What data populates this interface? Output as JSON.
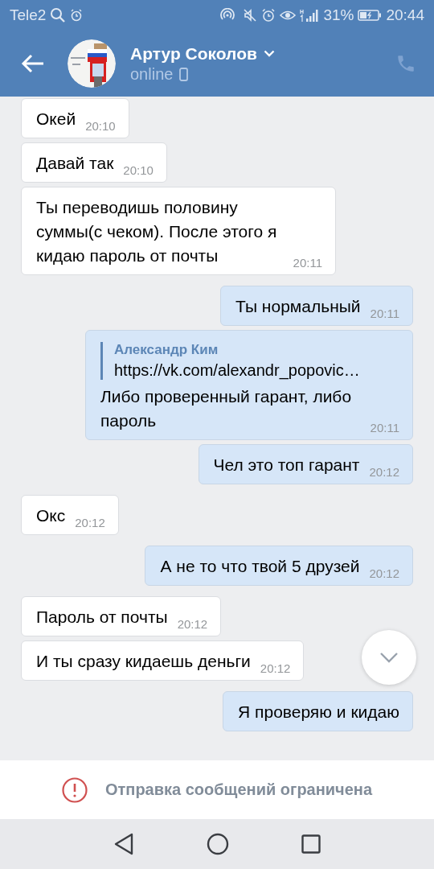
{
  "status_bar": {
    "carrier": "Tele2",
    "battery": "31%",
    "time": "20:44"
  },
  "header": {
    "name": "Артур Соколов",
    "status": "online"
  },
  "messages": [
    {
      "kind": "in",
      "text": "Окей",
      "time": "20:10"
    },
    {
      "kind": "in",
      "text": "Давай так",
      "time": "20:10"
    },
    {
      "kind": "in",
      "text": "Ты переводишь половину суммы(с чеком). После этого я кидаю пароль от почты",
      "time": "20:11"
    },
    {
      "kind": "out",
      "text": "Ты нормальный",
      "time": "20:11"
    },
    {
      "kind": "out",
      "reply": {
        "author": "Александр Ким",
        "text": "https://vk.com/alexandr_popovic…"
      },
      "text": "Либо проверенный гарант, либо пароль",
      "time": "20:11"
    },
    {
      "kind": "out",
      "text": "Чел это топ гарант",
      "time": "20:12"
    },
    {
      "kind": "in",
      "text": "Окс",
      "time": "20:12"
    },
    {
      "kind": "out",
      "text": "А не то что твой 5 друзей",
      "time": "20:12"
    },
    {
      "kind": "in",
      "text": "Пароль от почты",
      "time": "20:12"
    },
    {
      "kind": "in",
      "text": "И ты сразу кидаешь деньги",
      "time": "20:12"
    },
    {
      "kind": "out",
      "text": "Я проверяю и кидаю"
    }
  ],
  "notice": "Отправка сообщений ограничена"
}
